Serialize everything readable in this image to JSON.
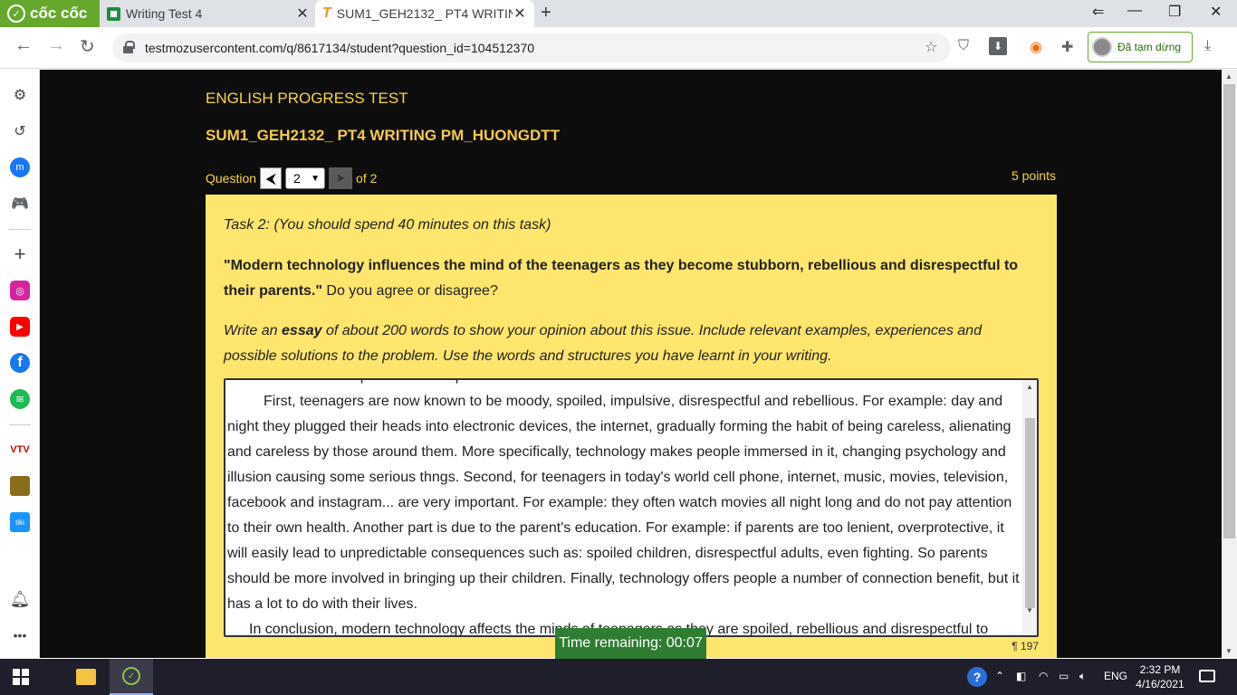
{
  "browser": {
    "brand": "cốc cốc",
    "tabs": [
      {
        "title": "Writing Test 4",
        "icon": "sheet-icon"
      },
      {
        "title": "SUM1_GEH2132_ PT4 WRITIN",
        "icon": "testmoz-t-icon",
        "active": true
      }
    ],
    "url": "testmozusercontent.com/q/8617134/student?question_id=104512370",
    "profile_status": "Đã tạm dừng"
  },
  "page": {
    "org_title": "ENGLISH PROGRESS TEST",
    "test_title": "SUM1_GEH2132_ PT4 WRITING PM_HUONGDTT",
    "question_label": "Question",
    "question_selected": "2",
    "question_of": "of 2",
    "points": "5 points",
    "task_line": "Task 2: (You should spend 40 minutes on this task)",
    "prompt_bold": "\"Modern technology influences the mind of the teenagers as they become stubborn, rebellious and disrespectful to their parents.\"",
    "prompt_rest": " Do you agree or disagree?",
    "instr_a": "Write an ",
    "instr_b": "essay",
    "instr_c": " of about 200 words to show your opinion about this issue. Include relevant examples, experiences and possible solutions to the problem. Use the words and structures you have learnt in your writing.",
    "answer_line0": "rebellious and disrespectful to their parents.",
    "answer_p1": "First, teenagers are now known to be moody, spoiled, impulsive, disrespectful and rebellious. For example: day and night they plugged their heads into electronic devices, the internet, gradually forming  the habit of being careless, alienating and careless by those around them. More specifically, technology makes people immersed in it, changing psychology and illusion causing some serious thngs. Second, for teenagers in today's world cell phone, internet, music, movies, television, facebook and instagram... are very important. For example: they often watch movies all night long and do not pay attention to their own health. Another part is due to the parent's education. For example: if parents are too lenient, overprotective, it will easily lead to unpredictable consequences such as: spoiled children, disrespectful adults, even fighting. So parents should be more involved in bringing up their children. Finally, technology offers people a number of connection benefit, but it has a lot to do with their lives.",
    "answer_p2": "In conclusion, modern technology affects the minds of teenagers as they are spoiled, rebellious and disrespectful to",
    "word_count": "¶ 197",
    "timer": "Time remaining: 00:07"
  },
  "taskbar": {
    "lang": "ENG",
    "time": "2:32 PM",
    "date": "4/16/2021"
  },
  "colors": {
    "card_bg": "#fde56e",
    "heading": "#f5d547",
    "timer_bg": "#2f7d32",
    "brand_green": "#66a82e"
  }
}
